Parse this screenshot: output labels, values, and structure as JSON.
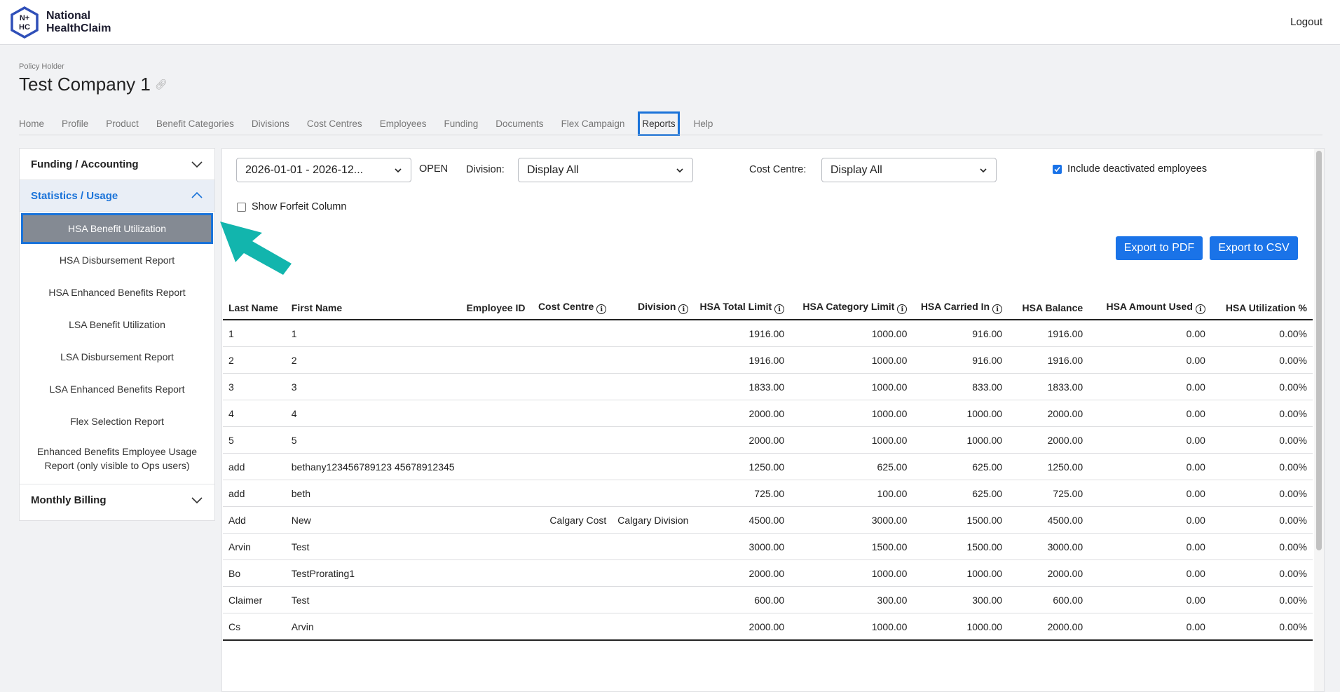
{
  "brand": {
    "line1": "National",
    "line2": "HealthClaim",
    "badge_top": "N+",
    "badge_bottom": "HC"
  },
  "header": {
    "logout": "Logout",
    "policy_holder_label": "Policy Holder",
    "company_name": "Test Company 1"
  },
  "nav": {
    "tabs": [
      {
        "label": "Home"
      },
      {
        "label": "Profile"
      },
      {
        "label": "Product"
      },
      {
        "label": "Benefit Categories"
      },
      {
        "label": "Divisions"
      },
      {
        "label": "Cost Centres"
      },
      {
        "label": "Employees"
      },
      {
        "label": "Funding"
      },
      {
        "label": "Documents"
      },
      {
        "label": "Flex Campaign"
      },
      {
        "label": "Reports"
      },
      {
        "label": "Help"
      }
    ],
    "active": "Reports"
  },
  "sidebar": {
    "section1": "Funding / Accounting",
    "section2": "Statistics / Usage",
    "section3": "Monthly Billing",
    "items": [
      {
        "label": "HSA Benefit Utilization"
      },
      {
        "label": "HSA Disbursement Report"
      },
      {
        "label": "HSA Enhanced Benefits Report"
      },
      {
        "label": "LSA Benefit Utilization"
      },
      {
        "label": "LSA Disbursement Report"
      },
      {
        "label": "LSA Enhanced Benefits Report"
      },
      {
        "label": "Flex Selection Report"
      },
      {
        "label": "Enhanced Benefits Employee Usage Report (only visible to Ops users)"
      }
    ]
  },
  "filters": {
    "period": "2026-01-01 - 2026-12...",
    "period_status": "OPEN",
    "division_label": "Division:",
    "division_value": "Display All",
    "cost_centre_label": "Cost Centre:",
    "cost_centre_value": "Display All",
    "include_deactivated": "Include deactivated employees",
    "show_forfeit": "Show Forfeit Column",
    "export_pdf": "Export to PDF",
    "export_csv": "Export to CSV"
  },
  "table": {
    "columns": [
      "Last Name",
      "First Name",
      "Employee ID",
      "Cost Centre",
      "Division",
      "HSA Total Limit",
      "HSA Category Limit",
      "HSA Carried In",
      "HSA Balance",
      "HSA Amount Used",
      "HSA Utilization %"
    ],
    "rows": [
      [
        "1",
        "1",
        "",
        "",
        "",
        "1916.00",
        "1000.00",
        "916.00",
        "1916.00",
        "0.00",
        "0.00%"
      ],
      [
        "2",
        "2",
        "",
        "",
        "",
        "1916.00",
        "1000.00",
        "916.00",
        "1916.00",
        "0.00",
        "0.00%"
      ],
      [
        "3",
        "3",
        "",
        "",
        "",
        "1833.00",
        "1000.00",
        "833.00",
        "1833.00",
        "0.00",
        "0.00%"
      ],
      [
        "4",
        "4",
        "",
        "",
        "",
        "2000.00",
        "1000.00",
        "1000.00",
        "2000.00",
        "0.00",
        "0.00%"
      ],
      [
        "5",
        "5",
        "",
        "",
        "",
        "2000.00",
        "1000.00",
        "1000.00",
        "2000.00",
        "0.00",
        "0.00%"
      ],
      [
        "add",
        "bethany123456789123 45678912345",
        "",
        "",
        "",
        "1250.00",
        "625.00",
        "625.00",
        "1250.00",
        "0.00",
        "0.00%"
      ],
      [
        "add",
        "beth",
        "",
        "",
        "",
        "725.00",
        "100.00",
        "625.00",
        "725.00",
        "0.00",
        "0.00%"
      ],
      [
        "Add",
        "New",
        "",
        "Calgary Cost",
        "Calgary Division",
        "4500.00",
        "3000.00",
        "1500.00",
        "4500.00",
        "0.00",
        "0.00%"
      ],
      [
        "Arvin",
        "Test",
        "",
        "",
        "",
        "3000.00",
        "1500.00",
        "1500.00",
        "3000.00",
        "0.00",
        "0.00%"
      ],
      [
        "Bo",
        "TestProrating1",
        "",
        "",
        "",
        "2000.00",
        "1000.00",
        "1000.00",
        "2000.00",
        "0.00",
        "0.00%"
      ],
      [
        "Claimer",
        "Test",
        "",
        "",
        "",
        "600.00",
        "300.00",
        "300.00",
        "600.00",
        "0.00",
        "0.00%"
      ],
      [
        "Cs",
        "Arvin",
        "",
        "",
        "",
        "2000.00",
        "1000.00",
        "1000.00",
        "2000.00",
        "0.00",
        "0.00%"
      ]
    ]
  },
  "colors": {
    "accent": "#1a73e8",
    "highlight": "#1a73d9",
    "arrow": "#12b5ad",
    "selected_bg": "#848a93"
  }
}
